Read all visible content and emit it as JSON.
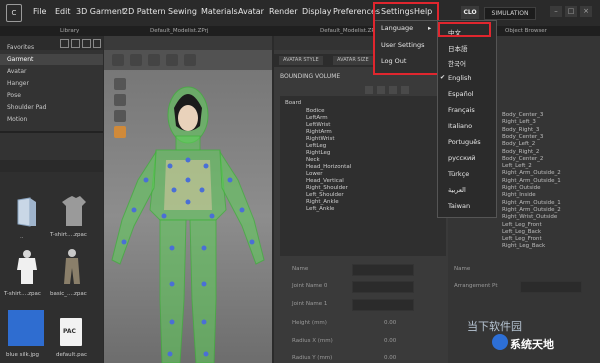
{
  "menubar": {
    "logo": "C",
    "items": [
      "File",
      "Edit",
      "3D Garment",
      "2D Pattern",
      "Sewing",
      "Materials",
      "Avatar",
      "Render",
      "Display",
      "Preferences",
      "Settings",
      "Help"
    ],
    "clo_badge": "CLO",
    "simulation": "SIMULATION"
  },
  "subbar": {
    "library_title": "Library",
    "viewport_title": "Default_Modelist.ZPrj",
    "pane2d_title": "Default_Modelist.ZPrj",
    "object_browser_title": "Object Browser"
  },
  "library": {
    "nav": [
      "Favorites",
      "Garment",
      "Avatar",
      "Hanger",
      "Pose",
      "Shoulder Pad",
      "Motion"
    ],
    "files": [
      {
        "name": "..",
        "kind": "folder"
      },
      {
        "name": "T-shirt....zpac",
        "kind": "shirt"
      },
      {
        "name": "T-shirt....zpac",
        "kind": "shirt-white"
      },
      {
        "name": "basic_....zpac",
        "kind": "pants"
      },
      {
        "name": "blue silk.jpg",
        "kind": "blue"
      },
      {
        "name": "default.pac",
        "kind": "pac"
      }
    ],
    "pac_label": "PAC"
  },
  "pane2d": {
    "tabs": [
      "AVATAR STYLE",
      "AVATAR SIZE"
    ],
    "bounding_title": "BOUNDING VOLUME",
    "tree_root": "Board",
    "tree_items": [
      "Bodice",
      "LeftArm",
      "LeftWrist",
      "RightArm",
      "RightWrist",
      "LeftLeg",
      "RightLeg",
      "Neck",
      "Head_Horizontal",
      "Lower",
      "Head_Vertical",
      "Right_Shoulder",
      "Left_Shoulder",
      "Right_Ankle",
      "Left_Ankle"
    ],
    "props": [
      {
        "label": "Name",
        "value": ""
      },
      {
        "label": "Joint Name 0",
        "value": ""
      },
      {
        "label": "Joint Name 1",
        "value": ""
      },
      {
        "label": "Height (mm)",
        "value": "0.00"
      },
      {
        "label": "Radius X (mm)",
        "value": "0.00"
      },
      {
        "label": "Radius Y (mm)",
        "value": "0.00"
      }
    ]
  },
  "object_browser": {
    "rows": [
      "Body_Center_3",
      "Right_Left_3",
      "Body_Right_3",
      "Body_Center_3",
      "Body_Left_2",
      "Body_Right_2",
      "Body_Center_2",
      "Left_Left_2",
      "Right_Arm_Outside_2",
      "Right_Arm_Outside_1",
      "Right_Outside",
      "Right_Inside",
      "Right_Arm_Outside_1",
      "Right_Arm_Outside_2",
      "Right_Wrist_Outside",
      "Left_Leg_Front",
      "Left_Leg_Back",
      "Left_Leg_Front",
      "Right_Leg_Back"
    ],
    "props": [
      {
        "label": "Name",
        "value": ""
      },
      {
        "label": "Arrangement Pt",
        "value": ""
      }
    ]
  },
  "settings_menu": {
    "items": [
      "Language",
      "User Settings",
      "Log Out"
    ],
    "submenu_arrow": "▸"
  },
  "language_menu": {
    "check": "✔",
    "selected": "English",
    "items": [
      "中文",
      "日本語",
      "한국어",
      "English",
      "Español",
      "Français",
      "Italiano",
      "Português",
      "русский",
      "Türkçe",
      "العربية",
      "Taiwan"
    ]
  },
  "watermark": {
    "line1": "当下软件园",
    "line2": "系统天地"
  },
  "colors": {
    "highlight_red": "#e0262e",
    "avatar_green": "#5fd25a",
    "joint_blue": "#4a6fd6"
  }
}
